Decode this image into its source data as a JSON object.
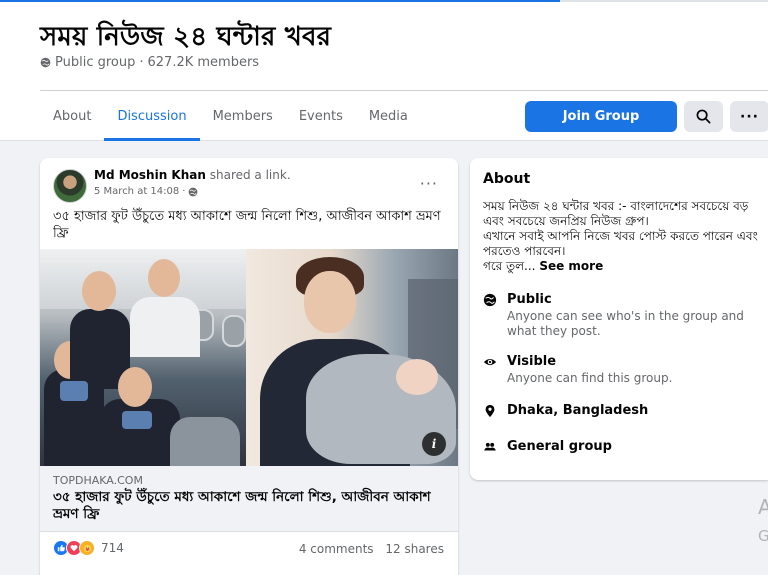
{
  "group": {
    "title": "সময় নিউজ ২৪ ঘন্টার খবর",
    "privacy": "Public group",
    "members": "627.2K members",
    "meta_separator": "·"
  },
  "tabs": [
    {
      "label": "About",
      "active": false
    },
    {
      "label": "Discussion",
      "active": true
    },
    {
      "label": "Members",
      "active": false
    },
    {
      "label": "Events",
      "active": false
    },
    {
      "label": "Media",
      "active": false
    }
  ],
  "actions": {
    "join_label": "Join Group",
    "more_label": "···"
  },
  "post": {
    "author": "Md Moshin Khan",
    "action": "shared a link.",
    "time": "5 March at 14:08",
    "time_separator": "·",
    "menu_label": "···",
    "text": "৩৫ হাজার ফুট উঁচুতে মধ্য আকাশে জন্ম নিলো শিশু, আজীবন আকাশ ভ্রমণ ফ্রি",
    "link_domain": "TOPDHAKA.COM",
    "link_title": "৩৫ হাজার ফুট উঁচুতে মধ্য আকাশে জন্ম নিলো শিশু, আজীবন আকাশ ভ্রমণ ফ্রি",
    "link_extra": "... ...",
    "reaction_count": "714",
    "comments": "4 comments",
    "shares": "12 shares"
  },
  "about": {
    "heading": "About",
    "desc_line1": "সময় নিউজ ২৪ ঘন্টার খবর :- বাংলাদেশের সবচেয়ে বড় এবং সবচেয়ে জনপ্রিয় নিউজ গ্রুপ।",
    "desc_line2": "এখানে সবাই আপনি নিজে খবর পোস্ট করতে পারেন এবং পরতেও পারবেন।",
    "desc_line3": "গরে তুল...",
    "see_more": "See more",
    "items": [
      {
        "icon": "globe-icon",
        "title": "Public",
        "desc": "Anyone can see who's in the group and what they post."
      },
      {
        "icon": "eye-icon",
        "title": "Visible",
        "desc": "Anyone can find this group."
      },
      {
        "icon": "location-pin-icon",
        "title": "Dhaka, Bangladesh",
        "desc": ""
      },
      {
        "icon": "people-icon",
        "title": "General group",
        "desc": ""
      }
    ]
  },
  "colors": {
    "accent": "#1b74e4",
    "page_bg": "#f0f2f5",
    "muted_text": "#65676b"
  }
}
